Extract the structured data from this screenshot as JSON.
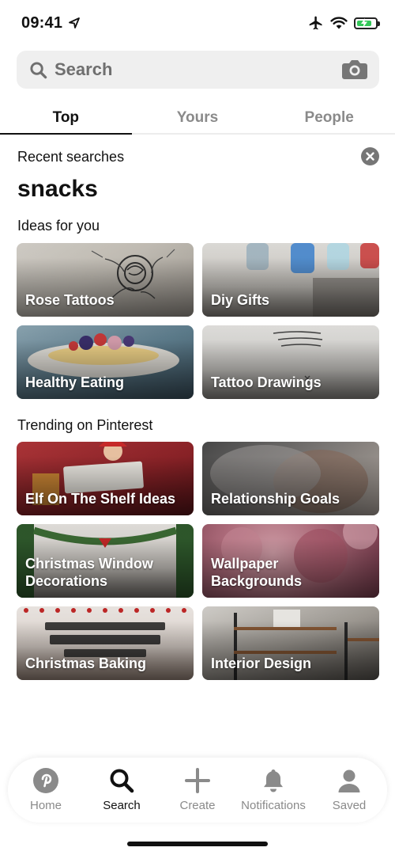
{
  "status_bar": {
    "time": "09:41"
  },
  "search": {
    "placeholder": "Search"
  },
  "tabs": [
    {
      "label": "Top",
      "active": true
    },
    {
      "label": "Yours",
      "active": false
    },
    {
      "label": "People",
      "active": false
    }
  ],
  "recent": {
    "heading": "Recent searches",
    "items": [
      "snacks"
    ]
  },
  "ideas": {
    "heading": "Ideas for you",
    "tiles": [
      {
        "label": "Rose Tattoos"
      },
      {
        "label": "Diy Gifts"
      },
      {
        "label": "Healthy Eating"
      },
      {
        "label": "Tattoo Drawings"
      }
    ]
  },
  "trending": {
    "heading": "Trending on Pinterest",
    "tiles": [
      {
        "label": "Elf On The Shelf Ideas"
      },
      {
        "label": "Relationship Goals"
      },
      {
        "label": "Christmas Window Decorations"
      },
      {
        "label": "Wallpaper Backgrounds"
      },
      {
        "label": "Christmas Baking"
      },
      {
        "label": "Interior Design"
      }
    ]
  },
  "nav": [
    {
      "label": "Home",
      "icon": "pinterest-logo-icon"
    },
    {
      "label": "Search",
      "icon": "search-icon",
      "active": true
    },
    {
      "label": "Create",
      "icon": "plus-icon"
    },
    {
      "label": "Notifications",
      "icon": "bell-icon"
    },
    {
      "label": "Saved",
      "icon": "profile-icon"
    }
  ],
  "colors": {
    "brand_red": "#e60023",
    "nav_gray": "#8a8a8a",
    "search_bg": "#efefef"
  }
}
